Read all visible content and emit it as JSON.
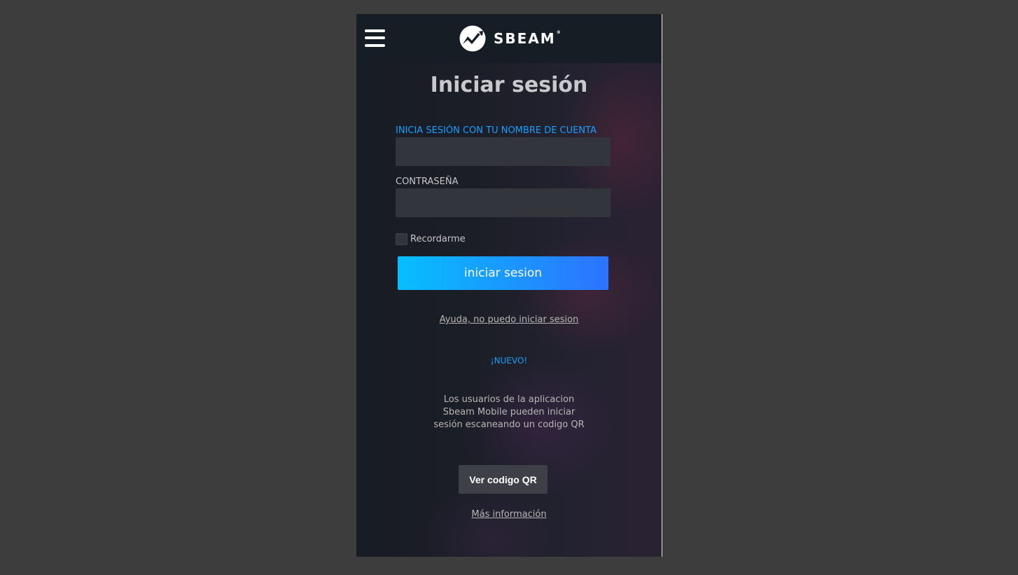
{
  "header": {
    "brand_name": "SBEAM",
    "brand_mark": "®"
  },
  "login": {
    "title": "Iniciar sesión",
    "account_label": "INICIA SESIÓN CON TU NOMBRE DE CUENTA",
    "account_value": "",
    "password_label": "CONTRASEÑA",
    "password_value": "",
    "remember_label": "Recordarme",
    "submit_label": "iniciar sesion",
    "help_link": "Ayuda, no puedo iniciar sesion"
  },
  "qr": {
    "badge": "¡NUEVO!",
    "description": "Los usuarios de la aplicacion Sbeam Mobile pueden iniciar sesión escaneando un codigo QR",
    "button_label": "Ver codigo QR",
    "more_info_link": "Más información"
  },
  "colors": {
    "accent": "#1a9fff",
    "button_gradient_start": "#06bfff",
    "button_gradient_end": "#2d73ff",
    "page_background": "#3d3d3d",
    "panel_background": "#181c24"
  },
  "icons": {
    "menu": "hamburger-menu-icon",
    "logo": "sbeam-logo-icon"
  }
}
